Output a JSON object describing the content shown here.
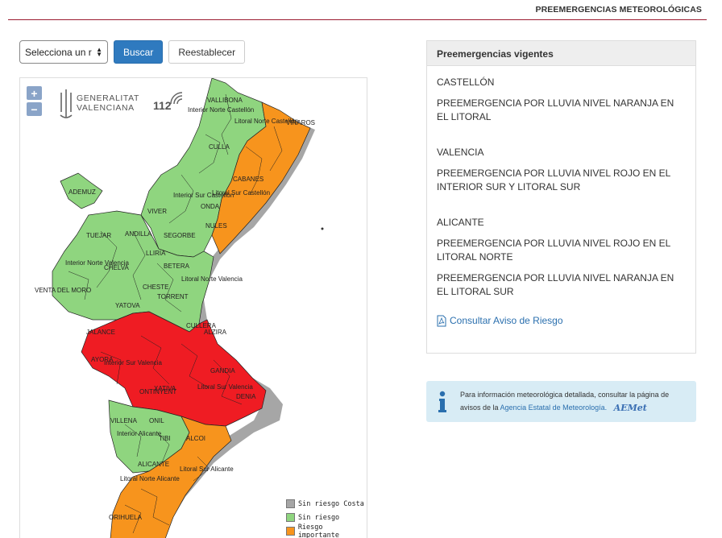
{
  "header": {
    "title": "PREEMERGENCIAS METEOROLÓGICAS"
  },
  "controls": {
    "select_value": "Selecciona un r",
    "search_label": "Buscar",
    "reset_label": "Reestablecer"
  },
  "map": {
    "zoom_in": "+",
    "zoom_out": "−",
    "gva_line1": "GENERALITAT",
    "gva_line2": "VALENCIANA",
    "logo_112": "112",
    "place_labels": [
      "VALLIBONA",
      "Interior Norte Castellón",
      "Litoral Norte Castellón",
      "VINAROS",
      "CULLA",
      "CABANES",
      "Litoral Sur Castellón",
      "Interior Sur Castellón",
      "ADEMUZ",
      "ONDA",
      "VIVER",
      "NULES",
      "SEGORBE",
      "TUEJAR",
      "CHELVA",
      "ANDILLA",
      "LLIRIA",
      "Interior Norte Valencia",
      "BETERA",
      "Litoral Norte Valencia",
      "CHESTE",
      "TORRENT",
      "VENTA DEL MORO",
      "YATOVA",
      "ALZIRA",
      "CULLERA",
      "JALANCE",
      "AYORA",
      "GANDIA",
      "Interior Sur Valencia",
      "Litoral Sur Valencia",
      "XATIVA",
      "ONTINYENT",
      "DENIA",
      "VILLENA",
      "Interior Alicante",
      "ONIL",
      "TIBI",
      "ALCOI",
      "Litoral Norte Alicante",
      "ALICANTE",
      "Litoral Sur Alicante",
      "ORIHUELA"
    ],
    "legend": [
      {
        "label": "Sin riesgo Costa",
        "color": "#a6a6a6"
      },
      {
        "label": "Sin riesgo",
        "color": "#8fd57f"
      },
      {
        "label": "Riesgo importante",
        "color": "#f7941d"
      }
    ],
    "colors": {
      "green": "#8fd57f",
      "orange": "#f7941d",
      "red": "#ef1c23",
      "coast": "#a6a6a6"
    }
  },
  "panel": {
    "title": "Preemergencias vigentes",
    "provinces": [
      {
        "name": "CASTELLÓN",
        "notices": [
          "PREEMERGENCIA POR LLUVIA NIVEL NARANJA EN EL LITORAL"
        ]
      },
      {
        "name": "VALENCIA",
        "notices": [
          "PREEMERGENCIA POR LLUVIA NIVEL ROJO EN EL INTERIOR SUR Y LITORAL SUR"
        ]
      },
      {
        "name": "ALICANTE",
        "notices": [
          "PREEMERGENCIA POR LLUVIA NIVEL ROJO EN EL LITORAL NORTE",
          "PREEMERGENCIA POR LLUVIA NIVEL NARANJA EN EL LITORAL SUR"
        ]
      }
    ],
    "link_label": "Consultar Aviso de Riesgo"
  },
  "info": {
    "text": "Para información meteorológica detallada, consultar la página de avisos de la",
    "link_text": "Agencia Estatal de Meteorología.",
    "aemet_logo": "AEMet"
  }
}
